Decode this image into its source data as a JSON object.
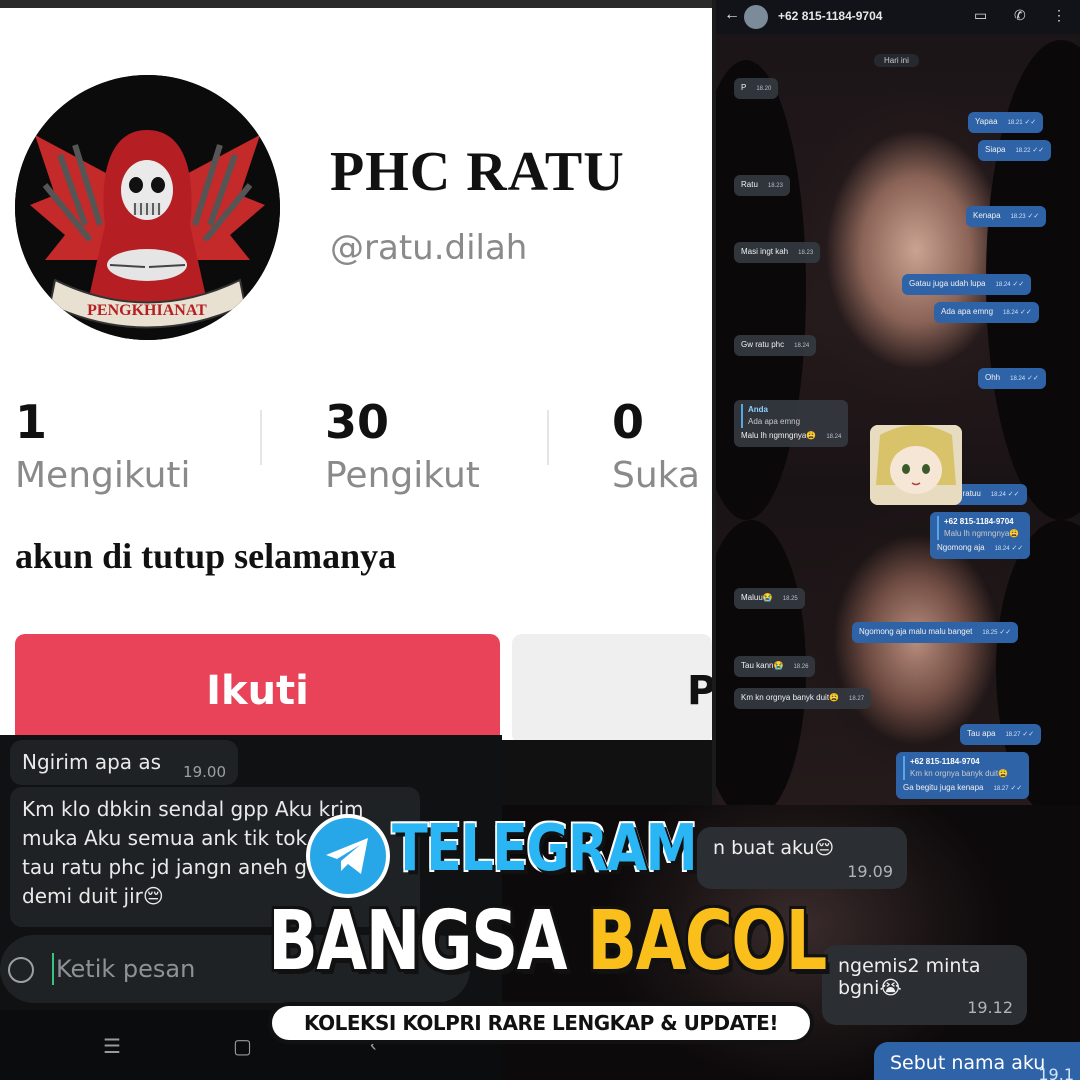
{
  "profile": {
    "display_name": "PHC RATU",
    "username": "@ratu.dilah",
    "avatar_banner_text": "PENGKHIANAT",
    "stats": [
      {
        "value": "1",
        "label": "Mengikuti"
      },
      {
        "value": "30",
        "label": "Pengikut"
      },
      {
        "value": "0",
        "label": "Suka"
      }
    ],
    "bio": "akun di tutup selamanya",
    "follow_label": "Ikuti",
    "message_label_partial": "P"
  },
  "right_chat": {
    "phone": "+62 815-1184-9704",
    "date_chip": "Hari ini",
    "messages": [
      {
        "text": "P",
        "time": "18.20",
        "dir": "in"
      },
      {
        "text": "Yapaa",
        "time": "18.21",
        "dir": "out"
      },
      {
        "text": "Siapa",
        "time": "18.22",
        "dir": "out"
      },
      {
        "text": "Ratu",
        "time": "18.23",
        "dir": "in"
      },
      {
        "text": "Kenapa",
        "time": "18.23",
        "dir": "out"
      },
      {
        "text": "Masi ingt kah",
        "time": "18.23",
        "dir": "in"
      },
      {
        "text": "Gatau juga udah lupa",
        "time": "18.24",
        "dir": "out"
      },
      {
        "text": "Ada apa emng",
        "time": "18.24",
        "dir": "out"
      },
      {
        "text": "Gw ratu phc",
        "time": "18.24",
        "dir": "in"
      },
      {
        "text": "Ohh",
        "time": "18.24",
        "dir": "out"
      },
      {
        "text": "Malu lh ngmngnya😩",
        "time": "18.24",
        "dir": "in",
        "quote_name": "Anda",
        "quote_text": "Ada apa emng"
      },
      {
        "text": "Iyaiya kenapa ratuu",
        "time": "18.24",
        "dir": "out"
      },
      {
        "text": "Ngomong aja",
        "time": "18.24",
        "dir": "out",
        "quote_name": "+62 815-1184-9704",
        "quote_text": "Malu lh ngmngnya😩"
      },
      {
        "text": "Maluu😭",
        "time": "18.25",
        "dir": "in"
      },
      {
        "text": "Ngomong aja malu malu banget",
        "time": "18.25",
        "dir": "out"
      },
      {
        "text": "Tau kann😭",
        "time": "18.26",
        "dir": "in"
      },
      {
        "text": "Km kn orgnya banyk duit😩",
        "time": "18.27",
        "dir": "in"
      },
      {
        "text": "Tau apa",
        "time": "18.27",
        "dir": "out"
      },
      {
        "text": "Ga begitu juga kenapa",
        "time": "18.27",
        "dir": "out",
        "quote_name": "+62 815-1184-9704",
        "quote_text": "Km kn orgnya banyk duit😩"
      }
    ]
  },
  "left_chat": {
    "messages": [
      {
        "text": "Ngirim apa as",
        "time": "19.00"
      },
      {
        "lines": [
          "Km klo dbkin sendal gpp Aku krim",
          "muka Aku semua ank tik tok",
          "tau ratu phc jd jangn aneh g",
          "demi duit jir😔"
        ]
      }
    ],
    "input_placeholder": "Ketik pesan",
    "nav": [
      "☰",
      "▢",
      "‹"
    ]
  },
  "bottom_right_chat": {
    "messages": [
      {
        "text": "n buat aku😔",
        "time": "19.09",
        "dir": "in"
      },
      {
        "text": "ngemis2 minta bgni😭",
        "time": "19.12",
        "dir": "in"
      },
      {
        "text": "Sebut nama aku",
        "time": "19.1",
        "dir": "out"
      }
    ]
  },
  "banner": {
    "title1": "TELEGRAM",
    "title2_white": "BANGSA",
    "title2_yellow": "BACOL",
    "subtitle": "KOLEKSI KOLPRI RARE LENGKAP & UPDATE!"
  },
  "colors": {
    "follow": "#e94359",
    "outgoing_bubble": "#2f63a8",
    "banner_blue": "#2ab5f5",
    "banner_yellow": "#fbbf1c"
  }
}
